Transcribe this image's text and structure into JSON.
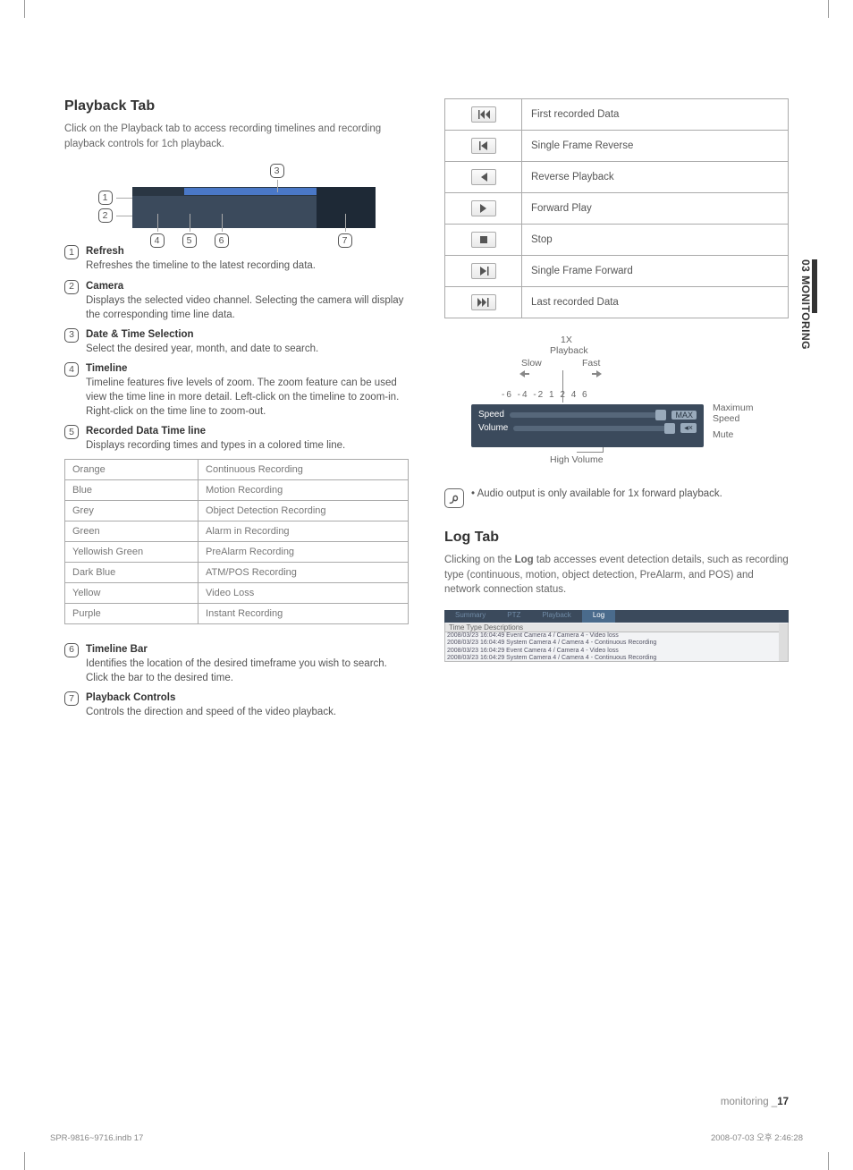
{
  "section_sidebar": "03 MONITORING",
  "left": {
    "heading": "Playback Tab",
    "intro": "Click on the Playback tab to access recording timelines and recording playback controls for 1ch playback.",
    "callouts": {
      "c1": "1",
      "c2": "2",
      "c3": "3",
      "c4": "4",
      "c5": "5",
      "c6": "6",
      "c7": "7"
    },
    "items": [
      {
        "num": "1",
        "title": "Refresh",
        "desc": "Refreshes the timeline to the latest recording data."
      },
      {
        "num": "2",
        "title": "Camera",
        "desc": "Displays the selected video channel. Selecting the camera will display the corresponding time line data."
      },
      {
        "num": "3",
        "title": "Date & Time Selection",
        "desc": "Select the desired year, month, and date to search."
      },
      {
        "num": "4",
        "title": "Timeline",
        "desc": "Timeline features five levels of zoom. The zoom feature can be used  view the time line in more detail. Left-click on the timeline to zoom-in. Right-click on the time line to zoom-out."
      },
      {
        "num": "5",
        "title": "Recorded Data Time line",
        "desc": "Displays recording times and types in a colored time line."
      }
    ],
    "color_table": [
      [
        "Orange",
        "Continuous Recording"
      ],
      [
        "Blue",
        "Motion Recording"
      ],
      [
        "Grey",
        "Object Detection Recording"
      ],
      [
        "Green",
        "Alarm in Recording"
      ],
      [
        "Yellowish Green",
        "PreAlarm Recording"
      ],
      [
        "Dark Blue",
        "ATM/POS Recording"
      ],
      [
        "Yellow",
        "Video Loss"
      ],
      [
        "Purple",
        "Instant Recording"
      ]
    ],
    "items2": [
      {
        "num": "6",
        "title": "Timeline Bar",
        "desc": "Identifies the location of the desired timeframe you wish to search. Click the bar to the desired time."
      },
      {
        "num": "7",
        "title": "Playback Controls",
        "desc": "Controls the direction and speed of the video playback."
      }
    ]
  },
  "right": {
    "btn_table": [
      "First recorded Data",
      "Single Frame Reverse",
      "Reverse Playback",
      "Forward Play",
      "Stop",
      "Single Frame Forward",
      "Last recorded Data"
    ],
    "diagram": {
      "one_x": "1X",
      "playback": "Playback",
      "slow": "Slow",
      "fast": "Fast",
      "ticks": "-6  -4  -2   1   2   4   6",
      "speed": "Speed",
      "volume": "Volume",
      "max": "MAX",
      "mute_ic": "◂×",
      "max_label": "Maximum Speed",
      "mute_label": "Mute",
      "high_vol": "High Volume"
    },
    "note": "Audio output is only available for 1x forward playback.",
    "log_heading": "Log Tab",
    "log_intro_pre": "Clicking on the ",
    "log_bold": "Log",
    "log_intro_post": " tab accesses event detection details, such as recording type (continuous, motion, object detection, PreAlarm, and POS) and network connection status.",
    "log_tabs": [
      "Summary",
      "PTZ",
      "Playback",
      "Log"
    ],
    "log_headers": "Time         Type     Descriptions",
    "log_rows": [
      "2008/03/23 16:04:49   Event    Camera 4 / Camera 4 - Video loss",
      "2008/03/23 16:04:49   System   Camera 4 / Camera 4 - Continuous Recording",
      "2008/03/23 16:04:29   Event    Camera 4 / Camera 4 - Video loss",
      "2008/03/23 16:04:29   System   Camera 4 / Camera 4 - Continuous Recording"
    ]
  },
  "footer": {
    "right_label": "monitoring _",
    "right_page": "17",
    "print_file": "SPR-9816~9716.indb   17",
    "print_date": "2008-07-03   오후 2:46:28"
  }
}
